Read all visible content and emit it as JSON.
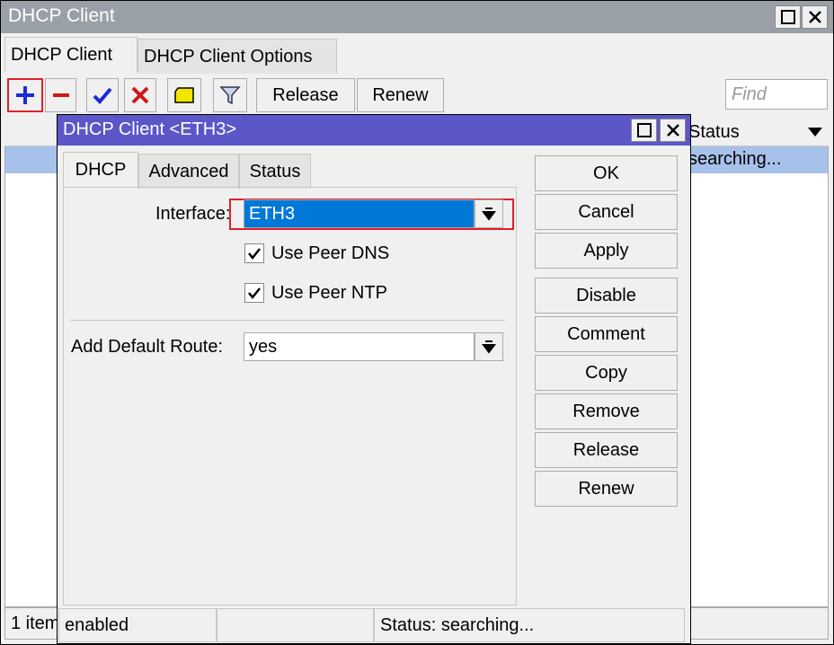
{
  "window": {
    "title": "DHCP Client"
  },
  "tabs": [
    {
      "label": "DHCP Client"
    },
    {
      "label": "DHCP Client Options"
    }
  ],
  "toolbar": {
    "release_label": "Release",
    "renew_label": "Renew",
    "find_placeholder": "Find"
  },
  "list": {
    "columns": [
      {
        "label": "Status"
      }
    ],
    "rows": [
      {
        "status": "searching..."
      }
    ],
    "footer": "1 item"
  },
  "dialog": {
    "title": "DHCP Client <ETH3>",
    "tabs": [
      {
        "label": "DHCP"
      },
      {
        "label": "Advanced"
      },
      {
        "label": "Status"
      }
    ],
    "interface_label": "Interface:",
    "interface_value": "ETH3",
    "use_peer_dns_label": "Use Peer DNS",
    "use_peer_dns_checked": true,
    "use_peer_ntp_label": "Use Peer NTP",
    "use_peer_ntp_checked": true,
    "add_default_route_label": "Add Default Route:",
    "add_default_route_value": "yes",
    "buttons": {
      "ok": "OK",
      "cancel": "Cancel",
      "apply": "Apply",
      "disable": "Disable",
      "comment": "Comment",
      "copy": "Copy",
      "remove": "Remove",
      "release": "Release",
      "renew": "Renew"
    },
    "status_bar": {
      "state": "enabled",
      "middle": "",
      "status": "Status: searching..."
    }
  },
  "colors": {
    "title_inactive": "#9aa0a8",
    "dialog_title": "#5b57c8",
    "selection": "#0078d7",
    "row_selected": "#a6c2ea",
    "highlight": "#e0202a"
  }
}
